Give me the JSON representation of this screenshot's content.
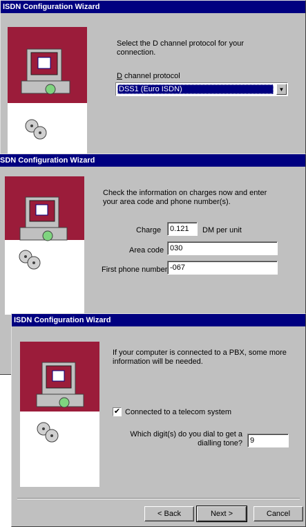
{
  "window1": {
    "title": "ISDN Configuration Wizard",
    "instruction": "Select the D channel protocol for your connection.",
    "protocol_label": "D channel protocol",
    "protocol_value": "DSS1 (Euro ISDN)"
  },
  "window2": {
    "title": "SDN Configuration Wizard",
    "instruction": "Check the information on charges now and enter your area code and phone number(s).",
    "charge_label": "Charge",
    "charge_value": "0.121",
    "charge_unit": "DM per unit",
    "area_label": "Area code",
    "area_value": "030",
    "phone_label": "First phone number",
    "phone_value": "-067"
  },
  "window3": {
    "title": "ISDN Configuration Wizard",
    "instruction": "If your computer is connected to a PBX, some more information will be needed.",
    "telecom_label": "Connected to a telecom system",
    "telecom_checked": "✔",
    "digit_question_line1": "Which digit(s) do you dial to get a",
    "digit_question_line2": "dialling tone?",
    "digit_value": "9",
    "back_label": "< Back",
    "next_label": "Next >",
    "cancel_label": "Cancel"
  },
  "colors": {
    "titlebar": "#000080",
    "dialog": "#c0c0c0",
    "banner": "#9b1c3a"
  }
}
